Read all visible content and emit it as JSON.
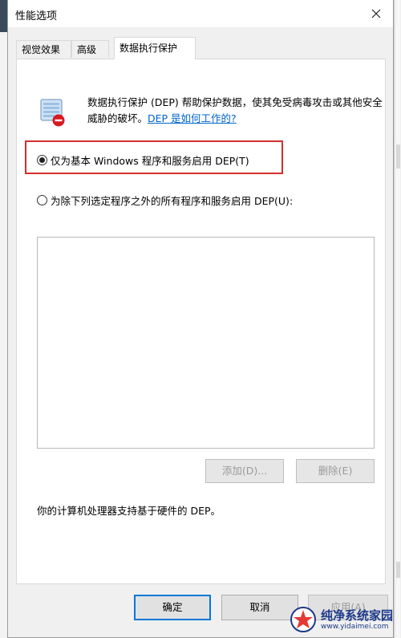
{
  "window": {
    "title": "性能选项"
  },
  "tabs": [
    {
      "label": "视觉效果",
      "active": false
    },
    {
      "label": "高级",
      "active": false
    },
    {
      "label": "数据执行保护",
      "active": true
    }
  ],
  "dep": {
    "icon": "dep-shield-icon",
    "description": "数据执行保护 (DEP) 帮助保护数据，使其免受病毒攻击或其他安全威胁的破坏。",
    "help_link": "DEP 是如何工作的?",
    "option_basic": "仅为基本 Windows 程序和服务启用 DEP(T)",
    "option_all_except": "为除下列选定程序之外的所有程序和服务启用 DEP(U):",
    "selected_option": "basic",
    "add_button": "添加(D)...",
    "remove_button": "删除(E)",
    "hardware_support": "你的计算机处理器支持基于硬件的 DEP。"
  },
  "footer": {
    "ok": "确定",
    "cancel": "取消",
    "apply": "应用(A)"
  },
  "watermark": {
    "name": "纯净系统家园",
    "url": "www.yidaimei.com"
  },
  "colors": {
    "highlight": "#d32f2f",
    "link": "#0066cc",
    "primary_border": "#0078d7"
  }
}
